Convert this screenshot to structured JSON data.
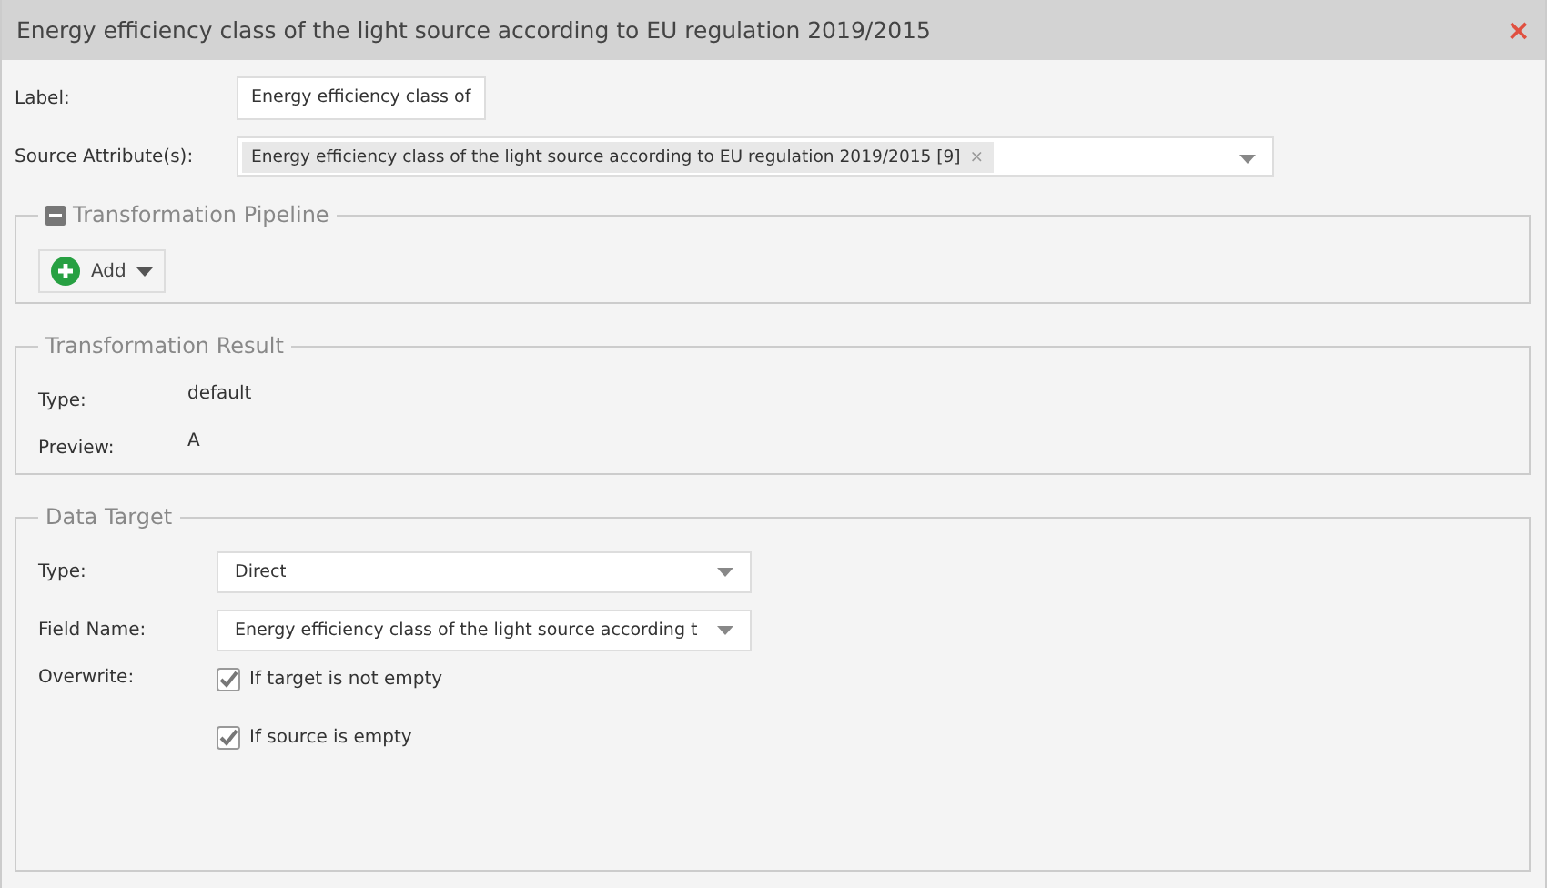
{
  "window": {
    "title": "Energy efficiency class of the light source according to EU regulation 2019/2015",
    "close": "×"
  },
  "label": {
    "caption": "Label:",
    "value": "Energy efficiency class of"
  },
  "source": {
    "caption": "Source Attribute(s):",
    "tags": [
      {
        "text": "Energy efficiency class of the light source according to EU regulation 2019/2015 [9]",
        "remove": "×"
      }
    ]
  },
  "pipeline": {
    "title": "Transformation Pipeline",
    "expanded": true,
    "add_button": "Add"
  },
  "result": {
    "title": "Transformation Result",
    "rows": [
      {
        "label": "Type:",
        "value": "default"
      },
      {
        "label": "Preview:",
        "value": "A"
      }
    ]
  },
  "target": {
    "title": "Data Target",
    "type": {
      "caption": "Type:",
      "value": "Direct"
    },
    "field_name": {
      "caption": "Field Name:",
      "value": "Energy efficiency class of the light source according t"
    },
    "overwrite": {
      "caption": "Overwrite:",
      "options": [
        {
          "label": "If target is not empty",
          "checked": true
        },
        {
          "label": "If source is empty",
          "checked": true
        }
      ]
    }
  }
}
